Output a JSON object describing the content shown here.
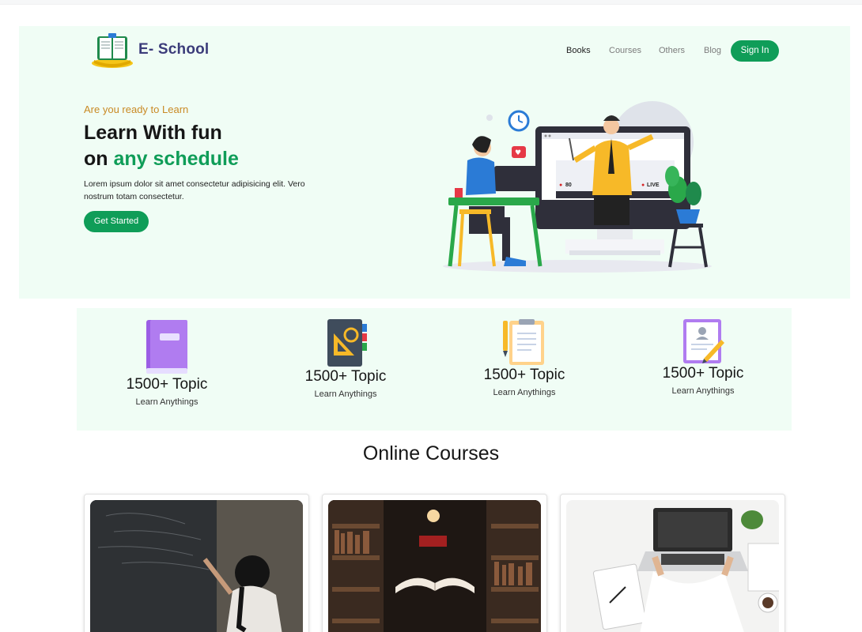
{
  "header": {
    "brand": "E- School",
    "nav": {
      "books": "Books",
      "courses": "Courses",
      "others": "Others",
      "blog": "Blog"
    },
    "signin": "Sign In"
  },
  "hero": {
    "kicker": "Are you ready to Learn",
    "title_line1": "Learn With fun",
    "title_line2_prefix": "on ",
    "title_line2_accent": "any schedule",
    "description": "Lorem ipsum dolor sit amet consectetur adipisicing elit. Vero nostrum totam consectetur.",
    "cta": "Get Started",
    "screen_views": "80",
    "screen_live": "LIVE"
  },
  "stats": [
    {
      "title": "1500+ Topic",
      "subtitle": "Learn Anythings",
      "icon": "purple-book-icon"
    },
    {
      "title": "1500+ Topic",
      "subtitle": "Learn Anythings",
      "icon": "geometry-notebook-icon"
    },
    {
      "title": "1500+ Topic",
      "subtitle": "Learn Anythings",
      "icon": "clipboard-pencil-icon"
    },
    {
      "title": "1500+ Topic",
      "subtitle": "Learn Anythings",
      "icon": "certificate-pen-icon"
    }
  ],
  "courses": {
    "title": "Online Courses",
    "cards": [
      {
        "image": "student-writing-on-chalkboard"
      },
      {
        "image": "open-book-in-library"
      },
      {
        "image": "laptop-and-notebook-on-desk"
      }
    ]
  },
  "colors": {
    "brand_green": "#0f9d58",
    "hero_bg": "#f0fdf5",
    "brand_text": "#3b3c7a",
    "kicker": "#c98a24"
  }
}
